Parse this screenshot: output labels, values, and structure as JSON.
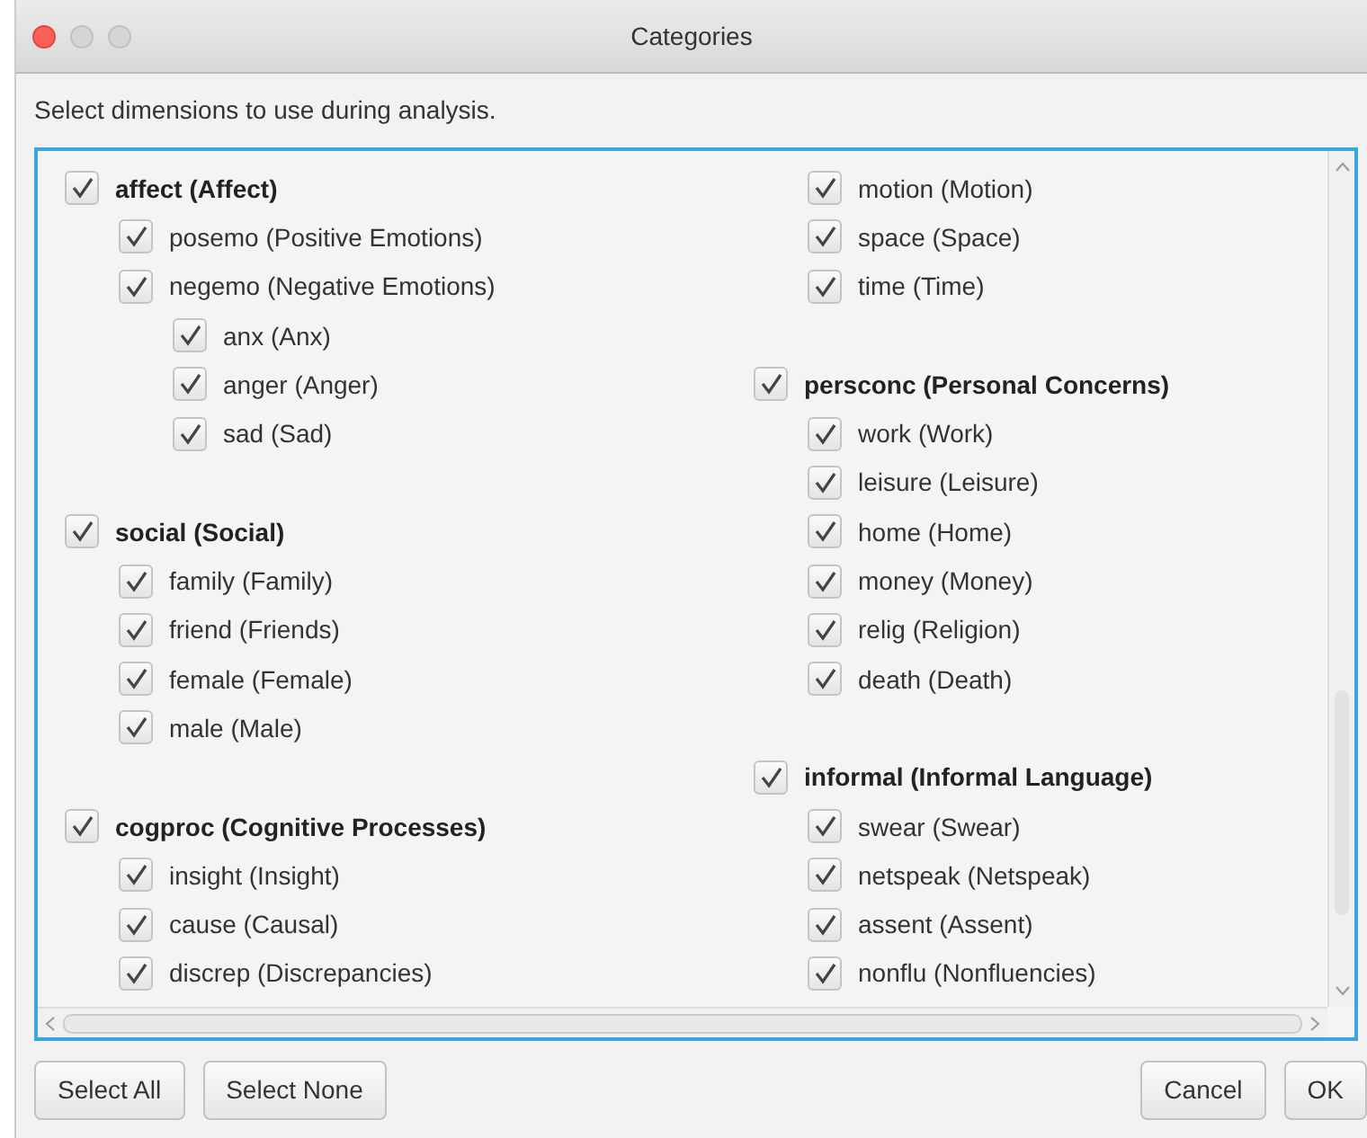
{
  "window": {
    "title": "Categories"
  },
  "instruction": "Select dimensions to use during analysis.",
  "columns": [
    {
      "nodes": [
        {
          "kind": "group",
          "label": "affect (Affect)",
          "checked": true,
          "children": [
            {
              "kind": "item",
              "label": "posemo (Positive Emotions)",
              "checked": true
            },
            {
              "kind": "item",
              "label": "negemo (Negative Emotions)",
              "checked": true,
              "children": [
                {
                  "kind": "item",
                  "label": "anx (Anx)",
                  "checked": true
                },
                {
                  "kind": "item",
                  "label": "anger (Anger)",
                  "checked": true
                },
                {
                  "kind": "item",
                  "label": "sad (Sad)",
                  "checked": true
                }
              ]
            }
          ]
        },
        {
          "kind": "group",
          "label": "social (Social)",
          "checked": true,
          "children": [
            {
              "kind": "item",
              "label": "family (Family)",
              "checked": true
            },
            {
              "kind": "item",
              "label": "friend (Friends)",
              "checked": true
            },
            {
              "kind": "item",
              "label": "female (Female)",
              "checked": true
            },
            {
              "kind": "item",
              "label": "male (Male)",
              "checked": true
            }
          ]
        },
        {
          "kind": "group",
          "label": "cogproc (Cognitive Processes)",
          "checked": true,
          "children": [
            {
              "kind": "item",
              "label": "insight (Insight)",
              "checked": true
            },
            {
              "kind": "item",
              "label": "cause (Causal)",
              "checked": true
            },
            {
              "kind": "item",
              "label": "discrep (Discrepancies)",
              "checked": true
            }
          ]
        }
      ]
    },
    {
      "nodes": [
        {
          "kind": "continued",
          "children": [
            {
              "kind": "item",
              "label": "motion (Motion)",
              "checked": true
            },
            {
              "kind": "item",
              "label": "space (Space)",
              "checked": true
            },
            {
              "kind": "item",
              "label": "time (Time)",
              "checked": true
            }
          ]
        },
        {
          "kind": "group",
          "label": "persconc (Personal Concerns)",
          "checked": true,
          "children": [
            {
              "kind": "item",
              "label": "work (Work)",
              "checked": true
            },
            {
              "kind": "item",
              "label": "leisure (Leisure)",
              "checked": true
            },
            {
              "kind": "item",
              "label": "home (Home)",
              "checked": true
            },
            {
              "kind": "item",
              "label": "money (Money)",
              "checked": true
            },
            {
              "kind": "item",
              "label": "relig (Religion)",
              "checked": true
            },
            {
              "kind": "item",
              "label": "death (Death)",
              "checked": true
            }
          ]
        },
        {
          "kind": "group",
          "label": "informal (Informal Language)",
          "checked": true,
          "children": [
            {
              "kind": "item",
              "label": "swear (Swear)",
              "checked": true
            },
            {
              "kind": "item",
              "label": "netspeak (Netspeak)",
              "checked": true
            },
            {
              "kind": "item",
              "label": "assent (Assent)",
              "checked": true
            },
            {
              "kind": "item",
              "label": "nonflu (Nonfluencies)",
              "checked": true
            }
          ]
        }
      ]
    }
  ],
  "left_buttons": [
    "Select All",
    "Select None"
  ],
  "right_buttons": [
    "Cancel",
    "OK"
  ]
}
